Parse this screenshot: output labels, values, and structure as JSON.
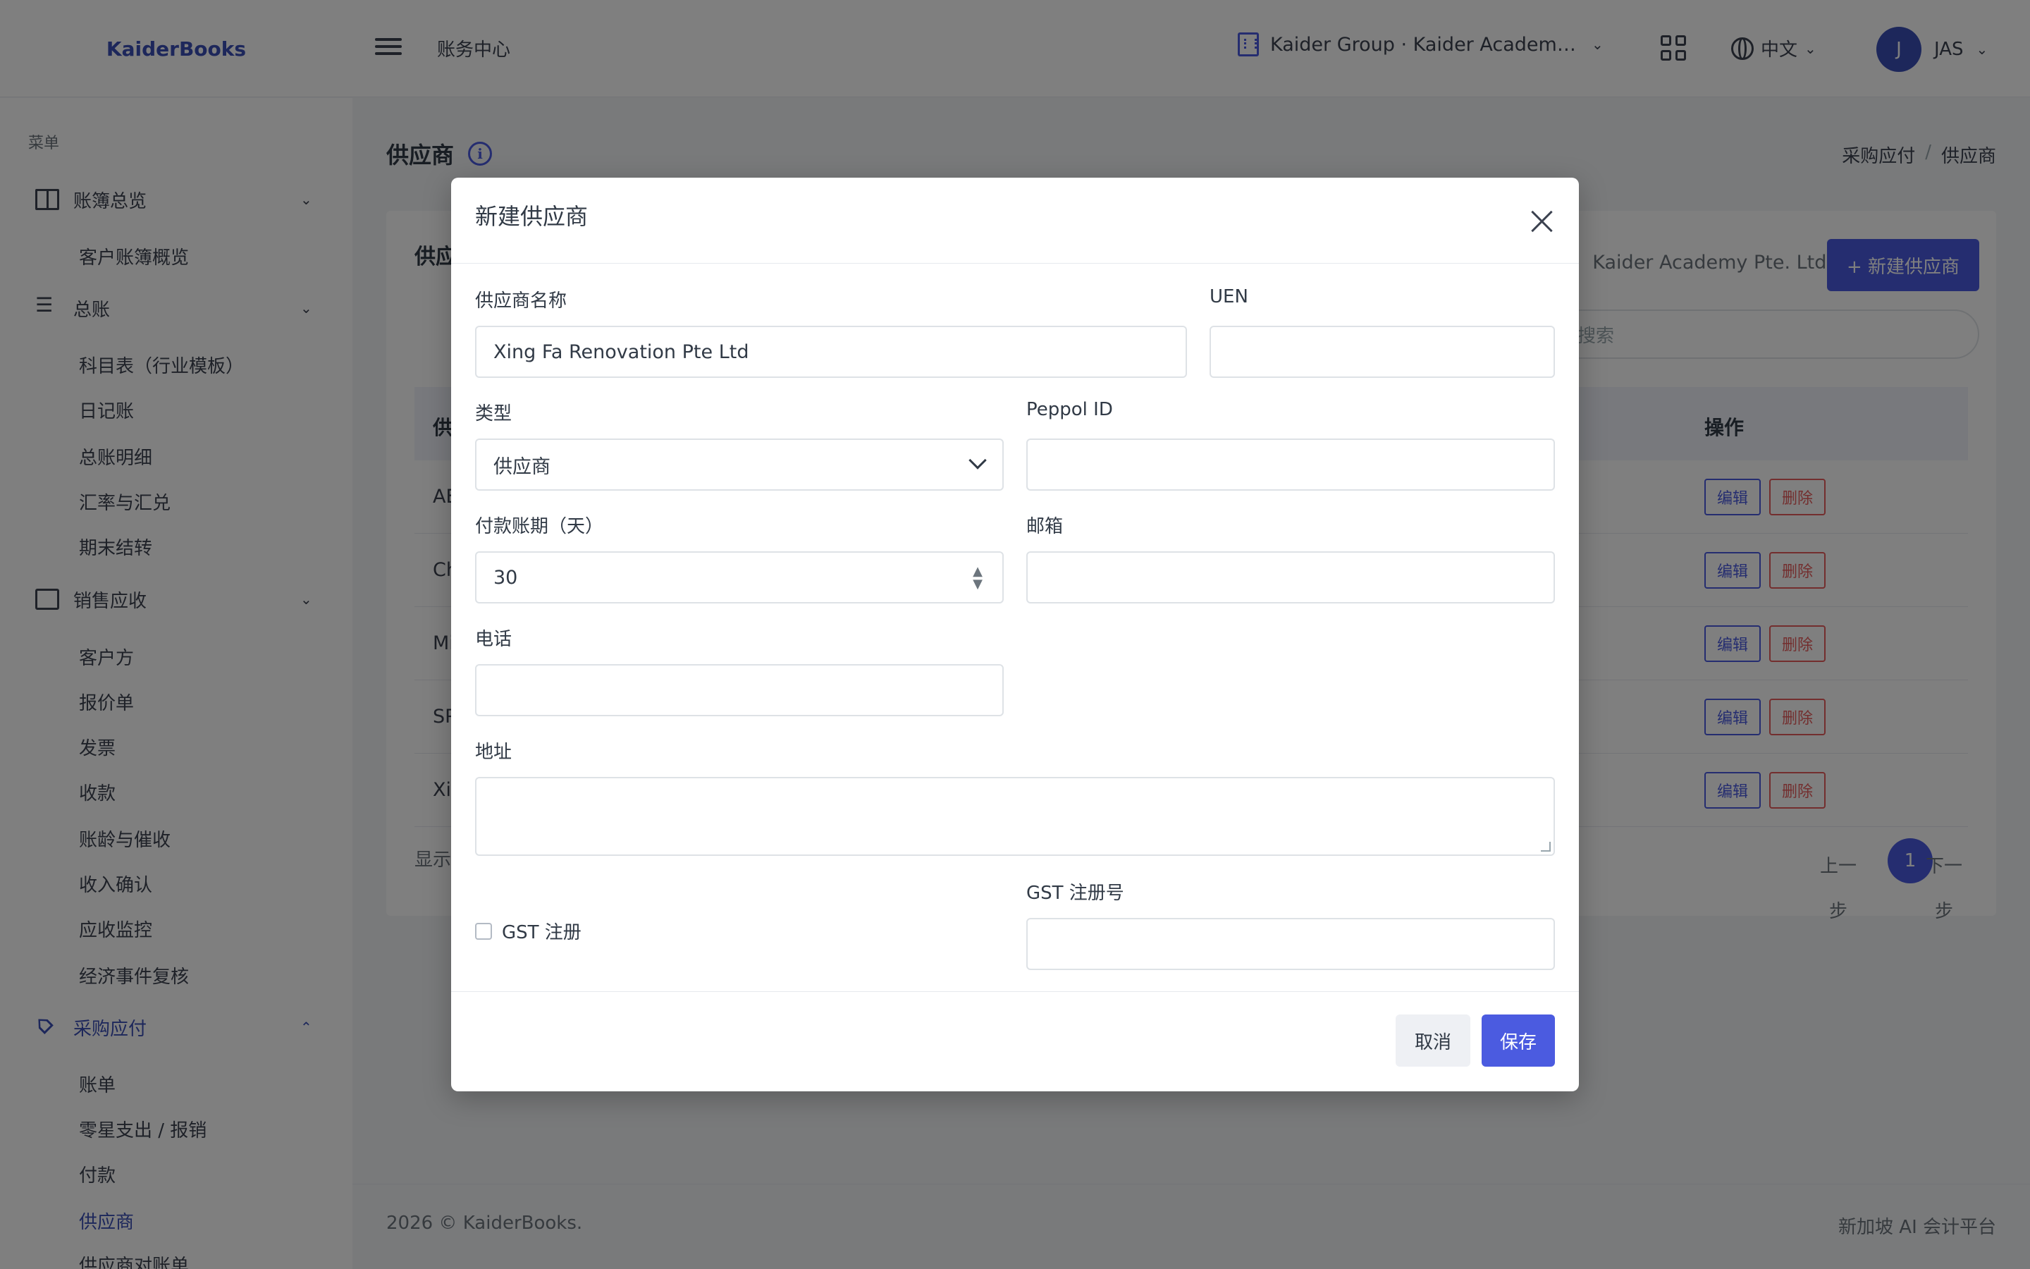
{
  "app": {
    "brand": "KaiderBooks",
    "topbar_title": "账务中心",
    "org_name": "Kaider Group · Kaider Academy Pte. Ltd.",
    "language": "中文",
    "user_initial": "J",
    "user_name": "JAS"
  },
  "sidebar": {
    "menu_label": "菜单",
    "groups": {
      "ledger_overview": {
        "label": "账簿总览",
        "icon": "book-icon",
        "items": [
          "客户账簿概览"
        ]
      },
      "general_ledger": {
        "label": "总账",
        "icon": "list-icon",
        "items": [
          "科目表（行业模板）",
          "日记账",
          "总账明细",
          "汇率与汇兑",
          "期末结转"
        ]
      },
      "sales": {
        "label": "销售应收",
        "icon": "document-icon",
        "items": [
          "客户方",
          "报价单",
          "发票",
          "收款",
          "账龄与催收",
          "收入确认",
          "应收监控",
          "经济事件复核"
        ]
      },
      "purchase": {
        "label": "采购应付",
        "icon": "tag-icon",
        "items": [
          "账单",
          "零星支出 / 报销",
          "付款",
          "供应商",
          "供应商对账单"
        ]
      }
    },
    "active_item": "供应商"
  },
  "page": {
    "title": "供应商",
    "breadcrumb": [
      "采购应付",
      "供应商"
    ],
    "card_title": "供应商",
    "card_org": "Kaider Academy Pte. Ltd.",
    "new_button": "+ 新建供应商",
    "search_placeholder": "搜索",
    "table": {
      "first_header": "供",
      "action_header": "操作",
      "rows": [
        {
          "name_start": "AE",
          "edit": "编辑",
          "delete": "删除"
        },
        {
          "name_start": "Ch",
          "edit": "编辑",
          "delete": "删除"
        },
        {
          "name_start": "Mi",
          "edit": "编辑",
          "delete": "删除"
        },
        {
          "name_start": "SP",
          "edit": "编辑",
          "delete": "删除"
        },
        {
          "name_start": "Xin",
          "edit": "编辑",
          "delete": "删除"
        }
      ]
    },
    "showing_prefix": "显示",
    "pagination": {
      "prev": "上一步",
      "current": "1",
      "next": "下一步"
    },
    "footer_left": "2026 © KaiderBooks.",
    "footer_right": "新加坡 AI 会计平台"
  },
  "modal": {
    "title": "新建供应商",
    "fields": {
      "name": {
        "label": "供应商名称",
        "value": "Xing Fa Renovation Pte Ltd"
      },
      "uen": {
        "label": "UEN",
        "value": ""
      },
      "type": {
        "label": "类型",
        "value": "供应商"
      },
      "peppol": {
        "label": "Peppol ID",
        "value": ""
      },
      "payment_terms": {
        "label": "付款账期（天）",
        "value": "30"
      },
      "email": {
        "label": "邮箱",
        "value": ""
      },
      "phone": {
        "label": "电话",
        "value": ""
      },
      "address": {
        "label": "地址",
        "value": ""
      },
      "gst_registered": {
        "label": "GST 注册",
        "checked": false
      },
      "gst_number": {
        "label": "GST 注册号",
        "value": ""
      }
    },
    "cancel": "取消",
    "save": "保存"
  },
  "colors": {
    "accent": "#4b5be0",
    "brand": "#3b4fb6",
    "danger": "#e65c5c"
  }
}
